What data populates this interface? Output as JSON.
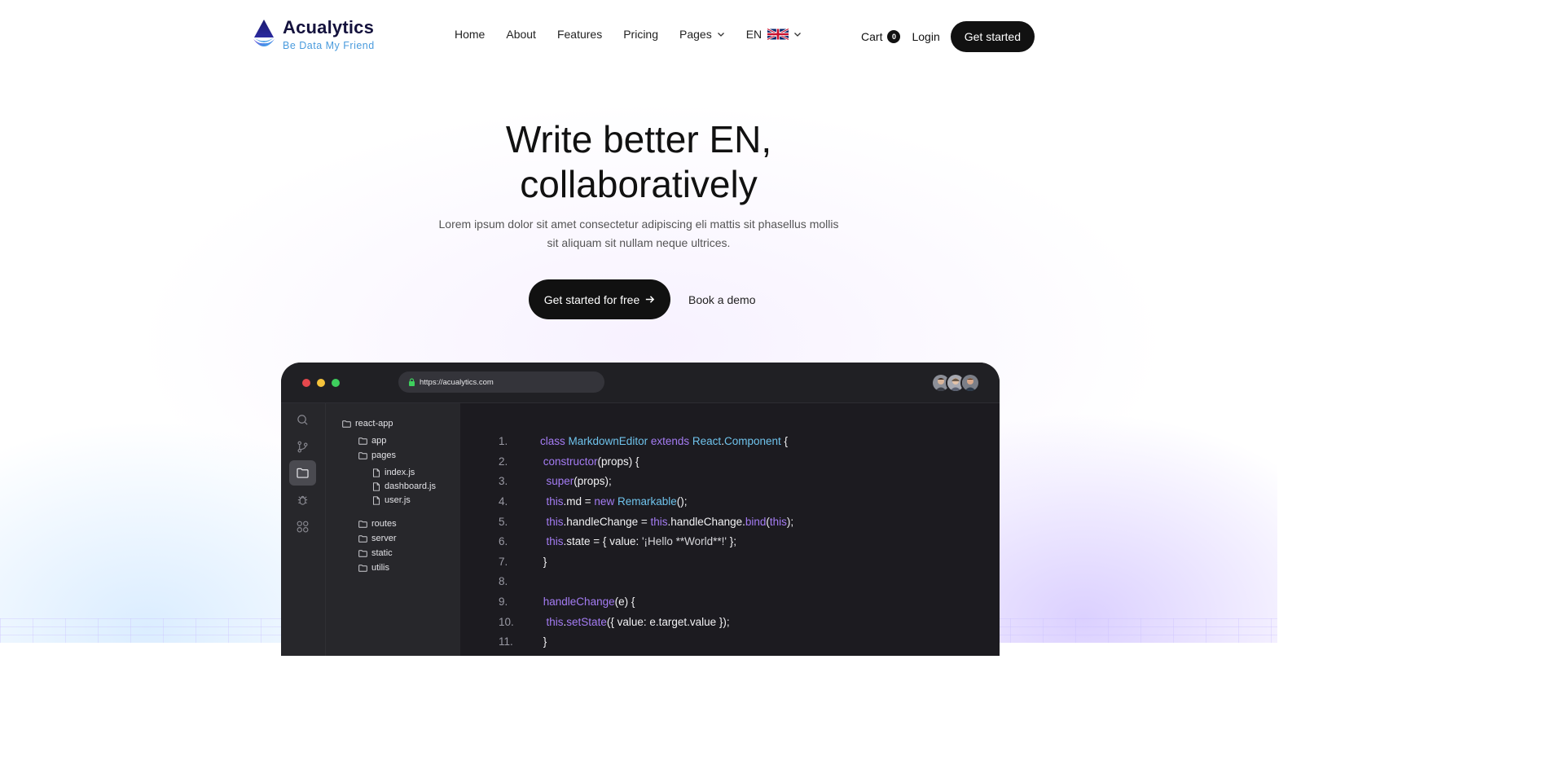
{
  "header": {
    "logo_title": "Acualytics",
    "logo_tagline": "Be Data My Friend",
    "nav": [
      {
        "label": "Home"
      },
      {
        "label": "About"
      },
      {
        "label": "Features"
      },
      {
        "label": "Pricing"
      },
      {
        "label": "Pages",
        "icon": "chevron-down-icon"
      },
      {
        "label": "EN",
        "icon": "uk-flag-icon"
      }
    ],
    "cart_label": "Cart",
    "cart_count": "0",
    "login_label": "Login",
    "get_started_label": "Get started"
  },
  "hero": {
    "title_line1": "Write better EN,",
    "title_line2": "collaboratively",
    "subtitle_line1": "Lorem ipsum dolor sit amet consectetur adipiscing eli mattis sit phasellus mollis",
    "subtitle_line2": "sit aliquam sit nullam neque ultrices.",
    "cta_primary": "Get started for free",
    "cta_secondary": "Book a demo"
  },
  "editor": {
    "url": "https://acualytics.com",
    "window_dots": [
      "#e5484d",
      "#f5c33b",
      "#3ecf5d"
    ],
    "activity_icons": [
      "search-icon",
      "git-branch-icon",
      "folder-icon",
      "bug-icon",
      "extensions-icon"
    ],
    "active_activity": "folder-icon",
    "tree": {
      "root": "react-app",
      "folders": [
        "app",
        "pages",
        "routes",
        "server",
        "static",
        "utilis"
      ],
      "files": [
        "index.js",
        "dashboard.js",
        "user.js"
      ]
    },
    "line_numbers": [
      "1.",
      "2.",
      "3.",
      "4.",
      "5.",
      "6.",
      "7.",
      "8.",
      "9.",
      "10.",
      "11."
    ]
  },
  "colors": {
    "keyword": "#a47cf3",
    "type": "#6fc3ec",
    "plain": "#f2f2f4",
    "brand_dark": "#14123d",
    "tagline": "#4a9bdd"
  }
}
